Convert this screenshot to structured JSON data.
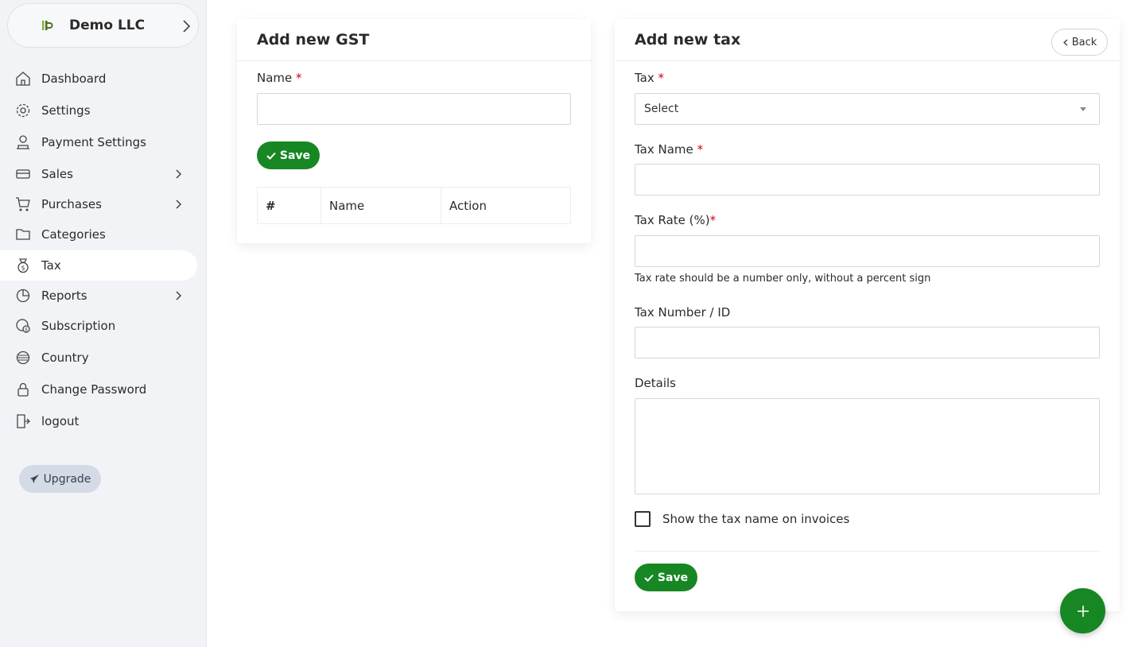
{
  "company": {
    "name": "Demo LLC"
  },
  "sidebar": {
    "items": [
      {
        "label": "Dashboard",
        "icon": "home-icon",
        "has_arrow": false,
        "active": false
      },
      {
        "label": "Settings",
        "icon": "gear-icon",
        "has_arrow": false,
        "active": false
      },
      {
        "label": "Payment Settings",
        "icon": "payment-icon",
        "has_arrow": false,
        "active": false
      },
      {
        "label": "Sales",
        "icon": "sales-icon",
        "has_arrow": true,
        "active": false
      },
      {
        "label": "Purchases",
        "icon": "cart-icon",
        "has_arrow": true,
        "active": false
      },
      {
        "label": "Categories",
        "icon": "folder-icon",
        "has_arrow": false,
        "active": false
      },
      {
        "label": "Tax",
        "icon": "tax-icon",
        "has_arrow": false,
        "active": true
      },
      {
        "label": "Reports",
        "icon": "reports-icon",
        "has_arrow": true,
        "active": false
      },
      {
        "label": "Subscription",
        "icon": "subscription-icon",
        "has_arrow": false,
        "active": false
      },
      {
        "label": "Country",
        "icon": "globe-icon",
        "has_arrow": false,
        "active": false
      },
      {
        "label": "Change Password",
        "icon": "lock-icon",
        "has_arrow": false,
        "active": false
      },
      {
        "label": "logout",
        "icon": "logout-icon",
        "has_arrow": false,
        "active": false
      }
    ],
    "upgrade_label": "Upgrade"
  },
  "gst_card": {
    "title": "Add new GST",
    "name_label": "Name",
    "required_mark": "*",
    "save_label": "Save",
    "table_headers": [
      "#",
      "Name",
      "Action"
    ]
  },
  "tax_card": {
    "title": "Add new tax",
    "back_label": "Back",
    "tax_label": "Tax",
    "tax_select_value": "Select",
    "tax_name_label": "Tax Name",
    "tax_rate_label": "Tax Rate (%)",
    "tax_rate_help": "Tax rate should be a number only, without a percent sign",
    "tax_number_label": "Tax Number / ID",
    "details_label": "Details",
    "show_on_invoice_label": "Show the tax name on invoices",
    "show_on_invoice_checked": false,
    "save_label": "Save",
    "required_mark": "*"
  },
  "colors": {
    "primary_green": "#178723",
    "sidebar_bg": "#f2f3f7",
    "required_red": "#d0021b"
  }
}
